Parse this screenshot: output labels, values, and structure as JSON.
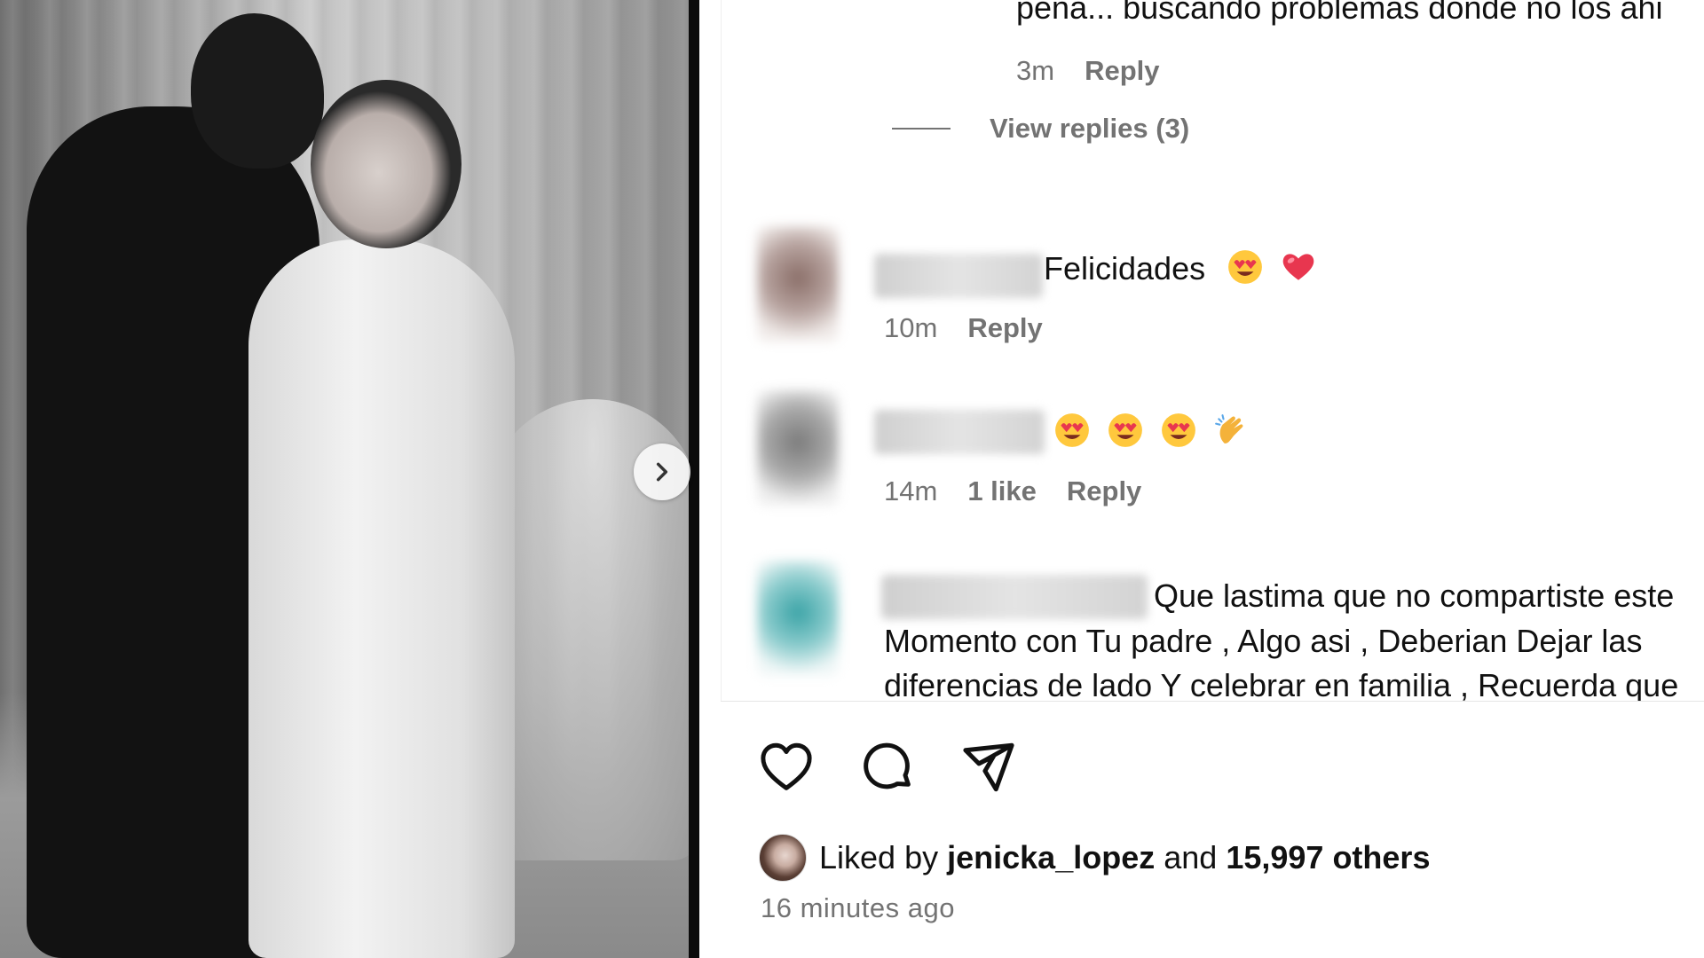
{
  "photo": {
    "description_icon": "next-chevron-icon"
  },
  "comments": {
    "previous": {
      "text_fragment": "pena... buscando problemas donde no los ahi",
      "time": "3m",
      "reply_label": "Reply",
      "view_replies": "View replies (3)"
    },
    "items": [
      {
        "text": "Felicidades",
        "emojis": [
          "heart-eyes-emoji",
          "red-heart-emoji"
        ],
        "time": "10m",
        "likes": "",
        "reply_label": "Reply",
        "avatar_color": "#8a6e68"
      },
      {
        "text": "",
        "emojis": [
          "heart-eyes-emoji",
          "heart-eyes-emoji",
          "heart-eyes-emoji",
          "clapping-hands-emoji"
        ],
        "time": "14m",
        "likes": "1 like",
        "reply_label": "Reply",
        "avatar_color": "#7b7b7b"
      },
      {
        "text_line1": "Que lastima que no compartiste este",
        "text_line2": "Momento con Tu padre , Algo asi , Deberian Dejar las",
        "text_line3": "diferencias de lado Y celebrar en familia , Recuerda que",
        "avatar_color": "#3aa3a6"
      }
    ]
  },
  "actions": {
    "like_icon": "heart-icon",
    "comment_icon": "comment-icon",
    "share_icon": "share-icon"
  },
  "likes": {
    "prefix": "Liked by",
    "user": "jenicka_lopez",
    "middle": "and",
    "others": "15,997 others"
  },
  "post_time": "16 minutes ago"
}
